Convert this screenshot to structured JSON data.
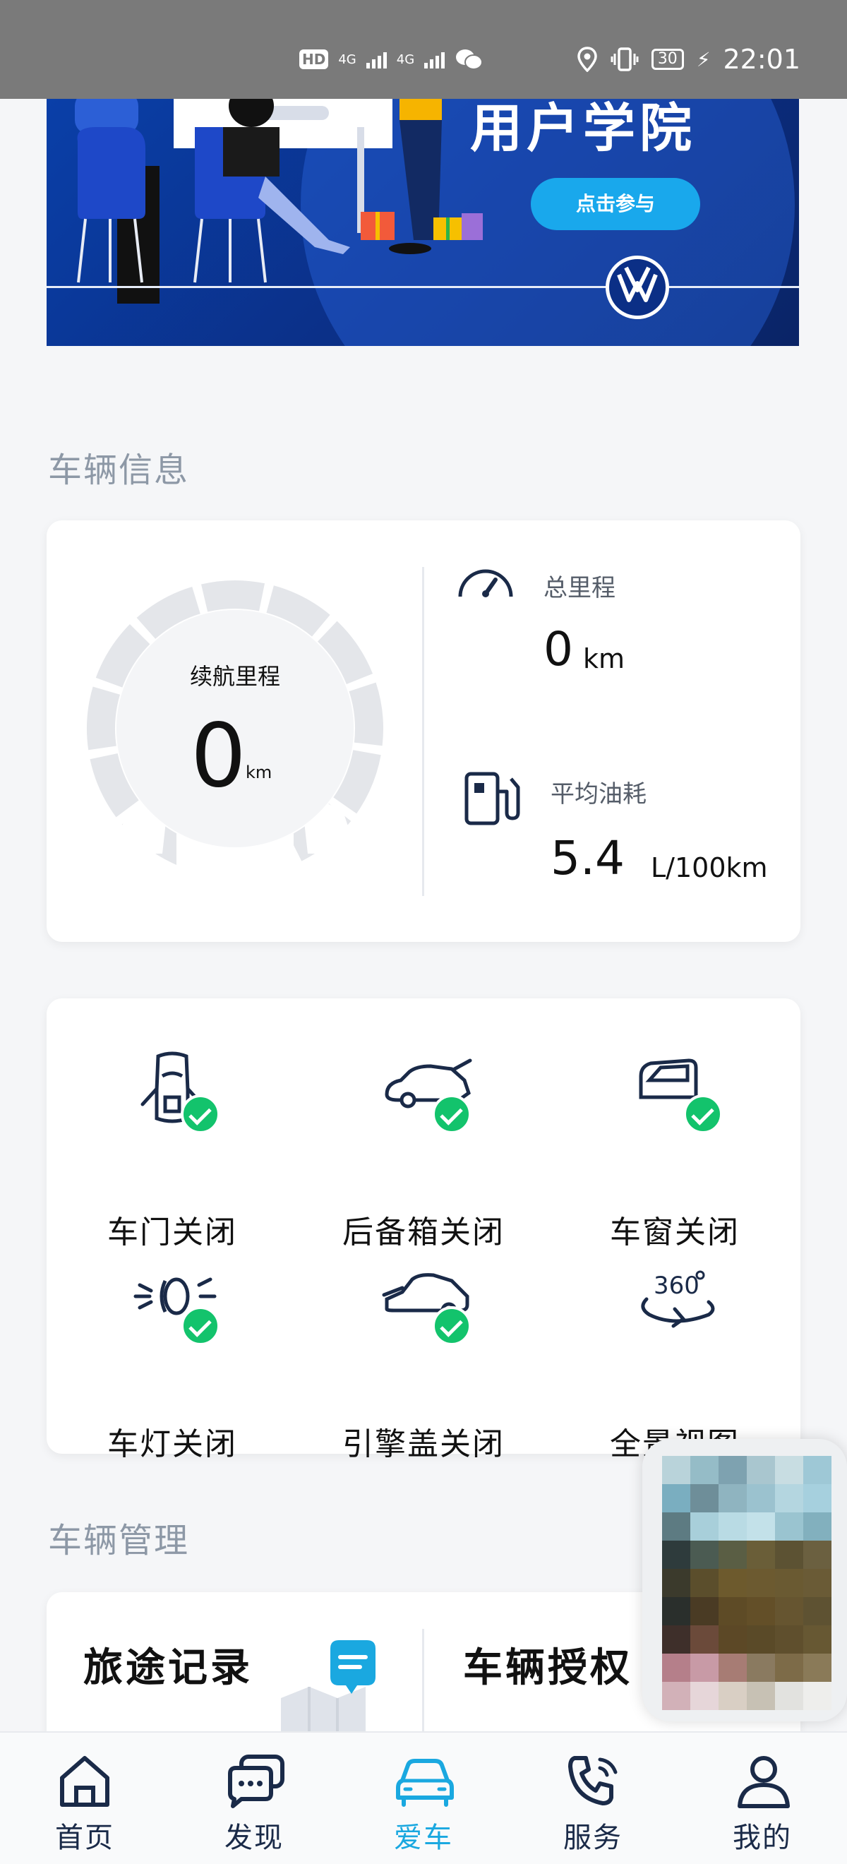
{
  "status_bar": {
    "hd": "HD",
    "net1": "4G",
    "net2": "4G",
    "battery": "30",
    "time": "22:01"
  },
  "banner": {
    "title": "用户学院",
    "cta_label": "点击参与",
    "logo": "volkswagen-logo"
  },
  "vehicle_info": {
    "section_title": "车辆信息",
    "range": {
      "label": "续航里程",
      "value": "0",
      "unit": "km"
    },
    "total_mileage": {
      "label": "总里程",
      "value": "0",
      "unit": "km"
    },
    "avg_fuel": {
      "label": "平均油耗",
      "value": "5.4",
      "unit": "L/100km"
    }
  },
  "status_items": [
    {
      "label": "车门关闭",
      "icon": "car-door-icon",
      "ok": true
    },
    {
      "label": "后备箱关闭",
      "icon": "trunk-icon",
      "ok": true
    },
    {
      "label": "车窗关闭",
      "icon": "car-window-icon",
      "ok": true
    },
    {
      "label": "车灯关闭",
      "icon": "car-light-icon",
      "ok": true
    },
    {
      "label": "引擎盖关闭",
      "icon": "hood-icon",
      "ok": true
    },
    {
      "label": "全景视图",
      "icon": "panorama-360-icon",
      "ok": false
    }
  ],
  "vehicle_management": {
    "section_title": "车辆管理",
    "items": [
      {
        "label": "旅途记录"
      },
      {
        "label": "车辆授权"
      }
    ]
  },
  "bottom_nav": [
    {
      "label": "首页",
      "icon": "home-icon",
      "active": false
    },
    {
      "label": "发现",
      "icon": "chat-icon",
      "active": false
    },
    {
      "label": "爱车",
      "icon": "car-icon",
      "active": true
    },
    {
      "label": "服务",
      "icon": "phone-icon",
      "active": false
    },
    {
      "label": "我的",
      "icon": "user-icon",
      "active": false
    }
  ],
  "colors": {
    "accent": "#1aa8e0",
    "check_green": "#13c36c",
    "navy": "#1a2a48",
    "banner_blue": "#0b2f86"
  }
}
